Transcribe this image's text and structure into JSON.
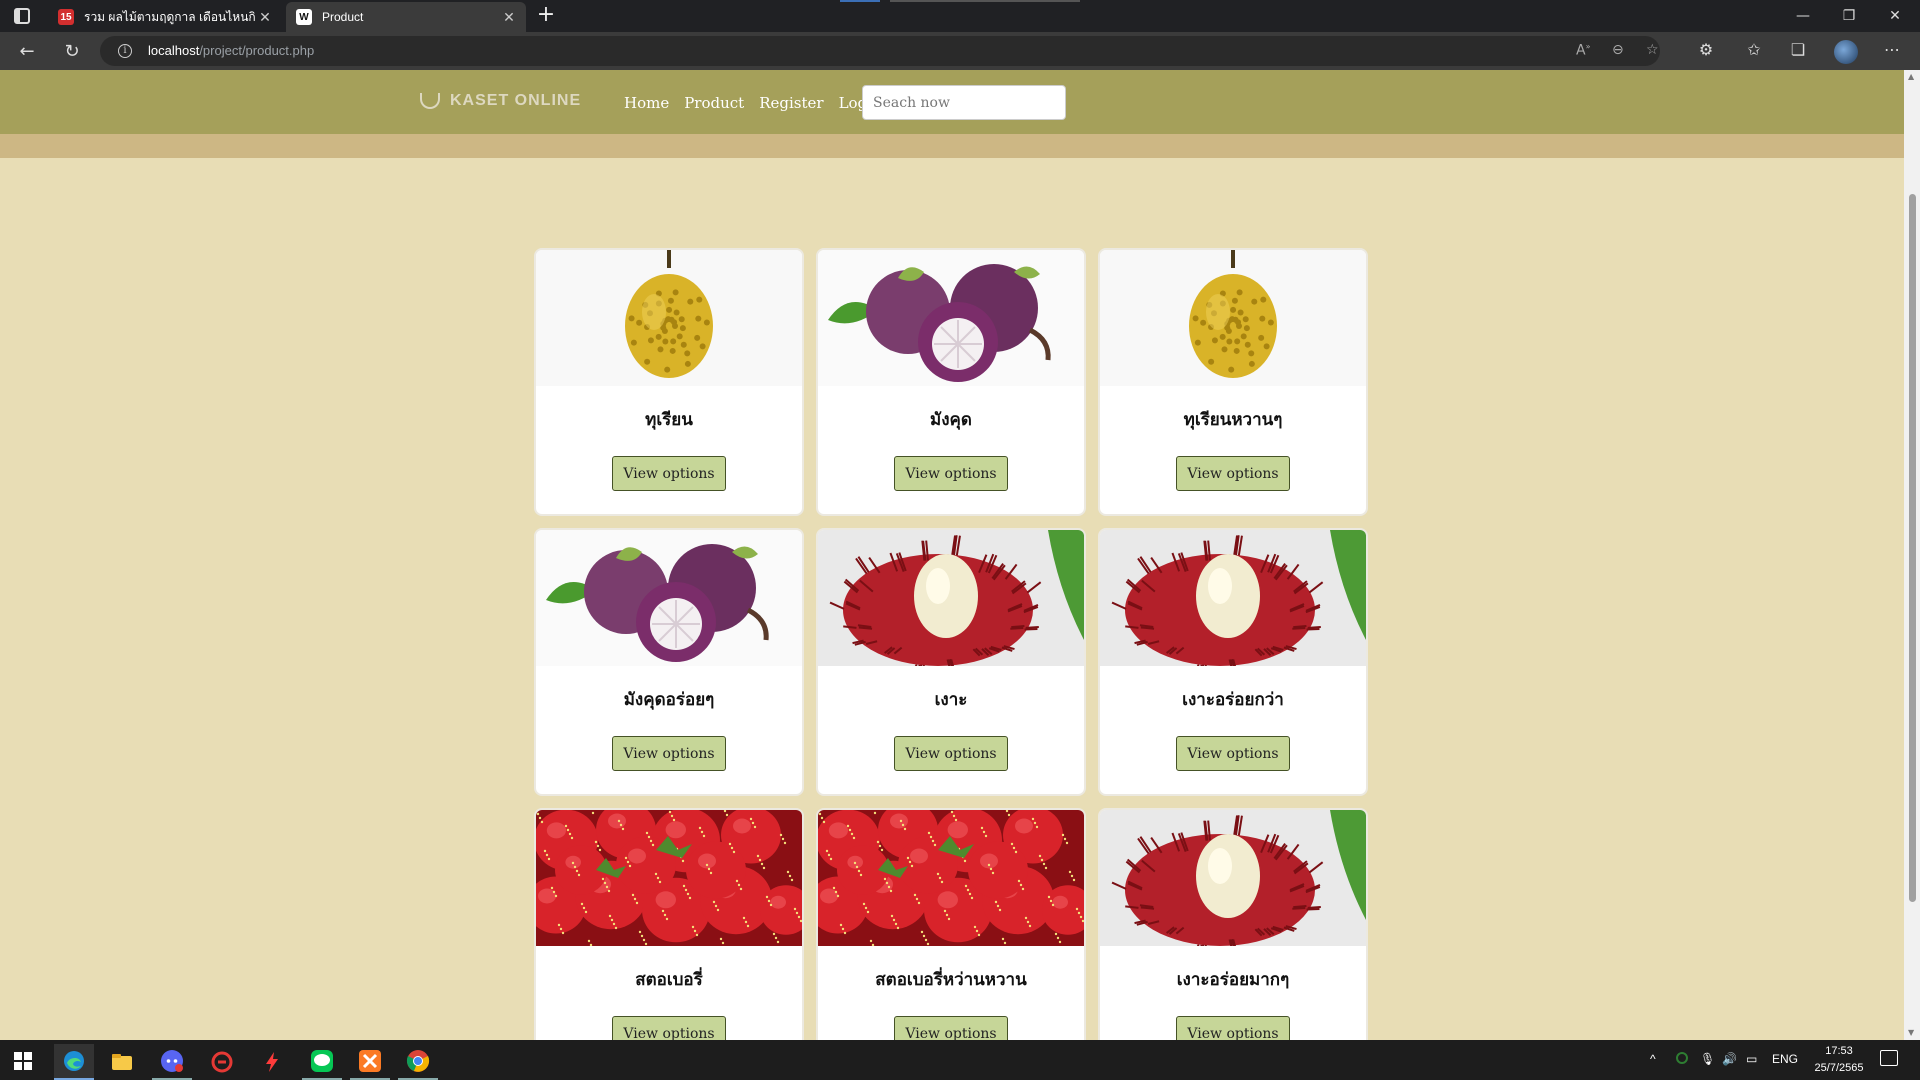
{
  "browser": {
    "tabs": [
      {
        "title": "รวม ผลไม้ตามฤดูกาล เดือนไหนกินผลไม้",
        "favicon": "news-site-favicon"
      },
      {
        "title": "Product",
        "favicon": "kaset-favicon"
      }
    ],
    "new_tab_symbol": "+",
    "url_host": "localhost",
    "url_path": "/project/product.php"
  },
  "site": {
    "logo_text": "KASET ONLINE",
    "nav": [
      "Home",
      "Product",
      "Register",
      "Login"
    ],
    "search_placeholder": "Seach now"
  },
  "products": [
    {
      "name": "ทุเรียน",
      "fruit": "durian",
      "button": "View options"
    },
    {
      "name": "มังคุด",
      "fruit": "mangosteen",
      "button": "View options"
    },
    {
      "name": "ทุเรียนหวานๆ",
      "fruit": "durian",
      "button": "View options"
    },
    {
      "name": "มังคุดอร่อยๆ",
      "fruit": "mangosteen",
      "button": "View options"
    },
    {
      "name": "เงาะ",
      "fruit": "rambutan",
      "button": "View options"
    },
    {
      "name": "เงาะอร่อยกว่า",
      "fruit": "rambutan",
      "button": "View options"
    },
    {
      "name": "สตอเบอรี่",
      "fruit": "strawberry",
      "button": "View options"
    },
    {
      "name": "สตอเบอรี่หว่านหวาน",
      "fruit": "strawberry",
      "button": "View options"
    },
    {
      "name": "เงาะอร่อยมากๆ",
      "fruit": "rambutan",
      "button": "View options"
    }
  ],
  "taskbar": {
    "apps": [
      "edge-icon",
      "file-explorer-icon",
      "discord-icon",
      "game-launcher-icon",
      "bolt-app-icon",
      "line-app-icon",
      "xampp-icon",
      "chrome-icon"
    ],
    "language": "ENG",
    "time": "17:53",
    "date": "25/7/2565"
  }
}
